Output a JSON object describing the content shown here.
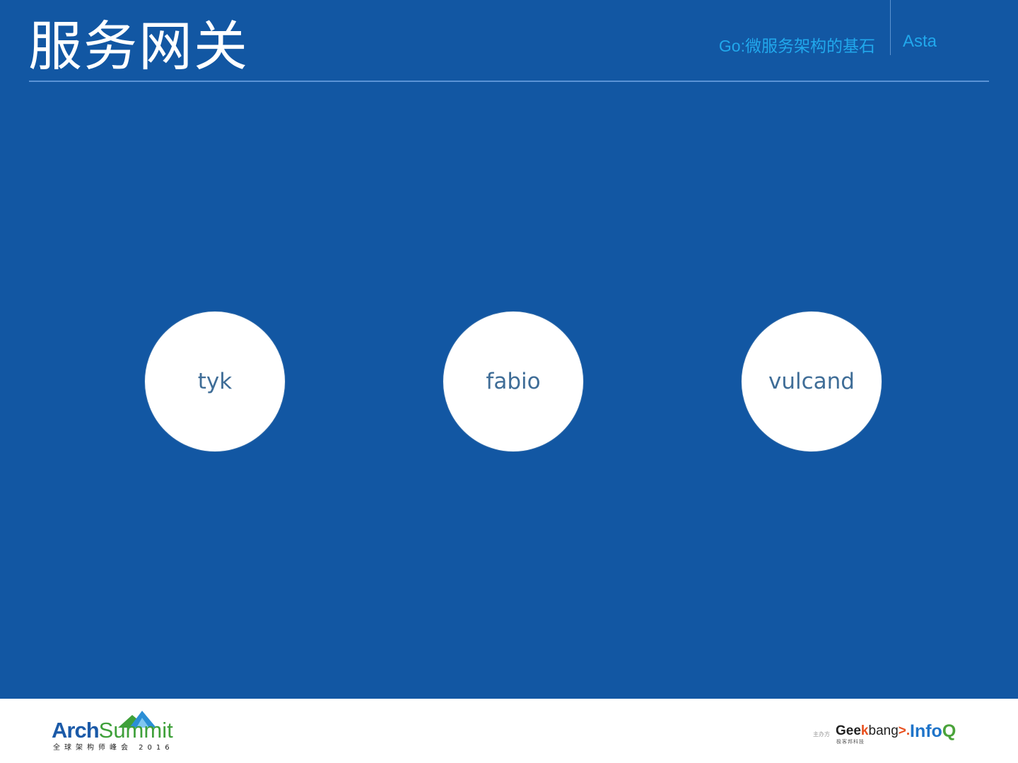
{
  "slide": {
    "title": "服务网关",
    "subtitle": "Go:微服务架构的基石",
    "author": "Asta",
    "gateways": [
      {
        "label": "tyk"
      },
      {
        "label": "fabio"
      },
      {
        "label": "vulcand"
      }
    ]
  },
  "footer": {
    "archsummit": {
      "arch": "Arch",
      "summit": "Summit",
      "subtitle": "全球架构师峰会 2016"
    },
    "organizer_label": "主办方",
    "geekbang": {
      "part1": "Gee",
      "k": "k",
      "part2": "bang",
      "arrow": ">.",
      "subtitle": "极客邦科技"
    },
    "infoq": {
      "info": "Info",
      "q": "Q"
    }
  },
  "colors": {
    "slide_background": "#1257a3",
    "title": "#ffffff",
    "subtitle": "#21a8ec",
    "circle_fill": "#ffffff",
    "circle_text": "#3f6d97"
  }
}
